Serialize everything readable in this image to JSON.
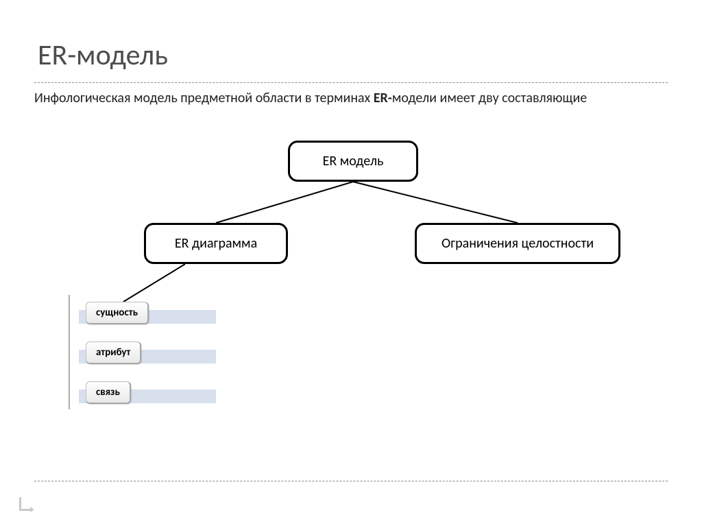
{
  "title": "ER-модель",
  "subtitle_plain_1": "Инфологическая модель предметной области в терминах ",
  "subtitle_bold_1": "ER-",
  "subtitle_plain_2": "модели имеет дву составляющие",
  "nodes": {
    "root": "ER модель",
    "left": "ER диаграмма",
    "right": "Ограничения целостности"
  },
  "list_items": [
    "сущность",
    "атрибут",
    "связь"
  ]
}
